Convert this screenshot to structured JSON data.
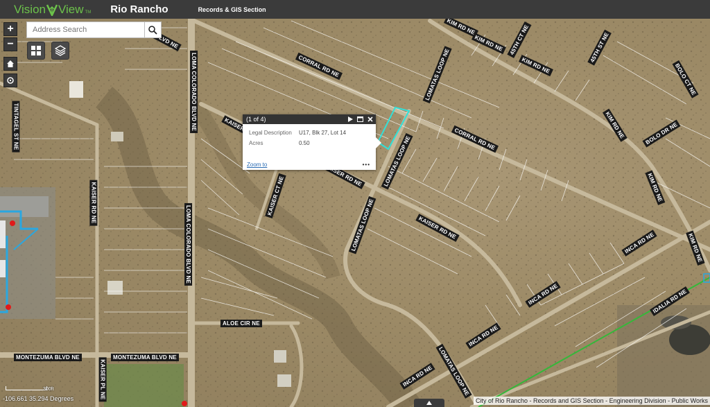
{
  "header": {
    "brand_part1": "Vision",
    "brand_part2": "View",
    "brand_tm": "TM",
    "city": "Rio Rancho",
    "section": "Records & GIS Section"
  },
  "search": {
    "placeholder": "Address Search"
  },
  "controls": {
    "zoom_in": "+",
    "zoom_out": "−"
  },
  "popup": {
    "counter": "(1 of 4)",
    "rows": [
      {
        "key": "Legal Description",
        "value": "U17, Blk 27, Lot 14"
      },
      {
        "key": "Acres",
        "value": "0.50"
      }
    ],
    "zoom_link": "Zoom to",
    "more": "•••"
  },
  "road_labels": [
    "KIM RD NE",
    "KIM RD NE",
    "45TH CT NE",
    "KIM RD NE",
    "45TH ST NE",
    "BOLO CT NE",
    "CORRAL RD NE",
    "LOMATAS LOOP NE",
    "CORRAL RD NE",
    "KIM RD NE",
    "BOLO DR NE",
    "KAISER RD NE",
    "LOMATAS LOOP NE",
    "KAISER RD NE",
    "KAISER CT NE",
    "LOMATAS LOOP NE",
    "KAISER RD NE",
    "KIM RD NE",
    "KIM RD NE",
    "INCA RD NE",
    "INCA RD NE",
    "IDALIA RD NE",
    "INCA RD NE",
    "INCA RD NE",
    "LOMATAS LOOP NE",
    "ALOE CIR NE",
    "MONTEZUMA BLVD NE",
    "MONTEZUMA BLVD NE",
    "KAISER RD NE",
    "LOMA COLORADO BLVD NE",
    "LOMA COLORADO BLVD NE",
    "TINTAGEL ST NE",
    "KAISER PL NE",
    "A BLVD NE"
  ],
  "status": {
    "coords": "-106.661 35.294 Degrees",
    "scale": "300ft",
    "attribution": "City of Rio Rancho - Records and GIS Section - Engineering Division - Public Works"
  },
  "colors": {
    "header_bg": "#3b3b3b",
    "brand_green": "#6dc24b",
    "highlight_cyan": "#33e0d8",
    "utility_green": "#35b83a",
    "utility_blue": "#2aa7e0"
  }
}
